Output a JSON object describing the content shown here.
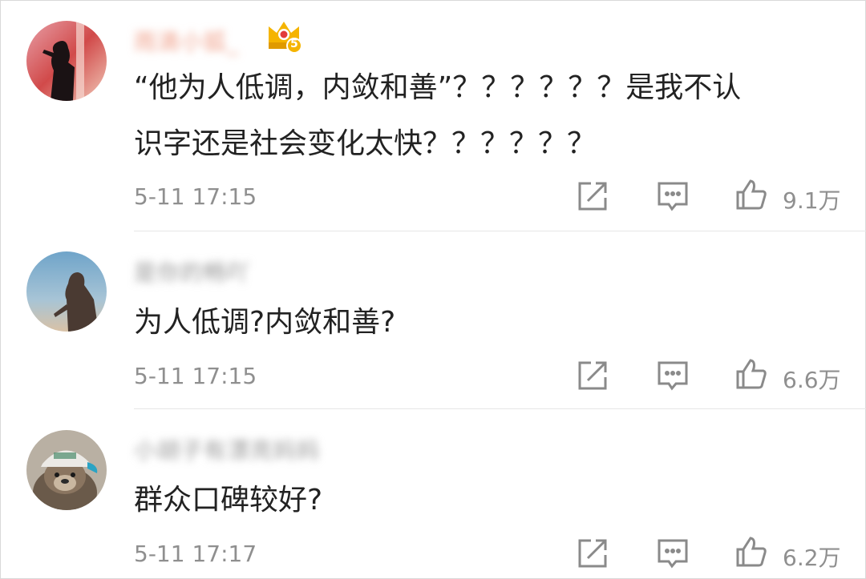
{
  "comments": [
    {
      "username": "雨滴小狐_",
      "badge_level": "5",
      "text_line1": "“他为人低调，内敛和善”？？？？？？是我不认",
      "text_line2": "识字还是社会变化太快？？？？？？",
      "time": "5-11 17:15",
      "likes": "9.1万"
    },
    {
      "username": "是你的畅吖",
      "text": "为人低调?内敛和善?",
      "time": "5-11 17:15",
      "likes": "6.6万"
    },
    {
      "username": "小胡子有漂亮妈妈",
      "text": "群众口碑较好?",
      "time": "5-11 17:17",
      "likes": "6.2万"
    }
  ],
  "icons": {
    "share": "share-icon",
    "comment": "comment-icon",
    "like": "thumbs-up-icon",
    "badge": "crown-badge-icon"
  },
  "colors": {
    "text": "#222222",
    "meta": "#8f8f8f",
    "icon": "#8a8a8a",
    "badge": "#f5b400"
  }
}
